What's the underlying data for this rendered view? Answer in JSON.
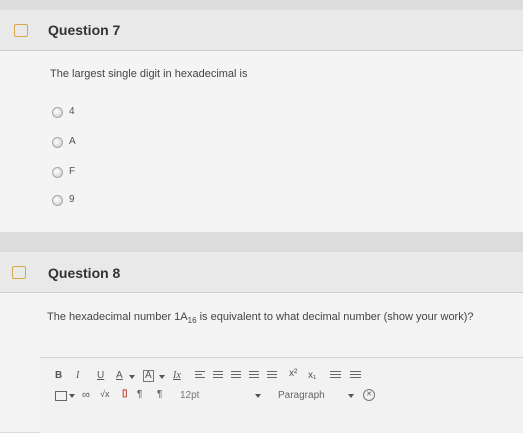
{
  "question7": {
    "title": "Question 7",
    "text": "The largest single digit in hexadecimal is",
    "options": [
      "4",
      "A",
      "F",
      "9"
    ]
  },
  "question8": {
    "title": "Question 8",
    "text_before": "The hexadecimal number 1A",
    "subscript": "16",
    "text_after": " is equivalent to what decimal number (show your work)?"
  },
  "editor": {
    "bold_label": "B",
    "italic_label": "I",
    "underline_label": "U",
    "font_color_label": "A",
    "highlight_label": "A",
    "clear_format_label": "Ix",
    "superscript_label": "x²",
    "subscript_label": "x₁",
    "font_size": "12pt",
    "paragraph_format": "Paragraph",
    "sqrt_label": "√x",
    "ltr_label": "¶",
    "rtl_label": "¶"
  },
  "colors": {
    "flag": "#d4a84b",
    "header_bg": "#e9e9e9",
    "card_bg": "#f4f4f4"
  }
}
